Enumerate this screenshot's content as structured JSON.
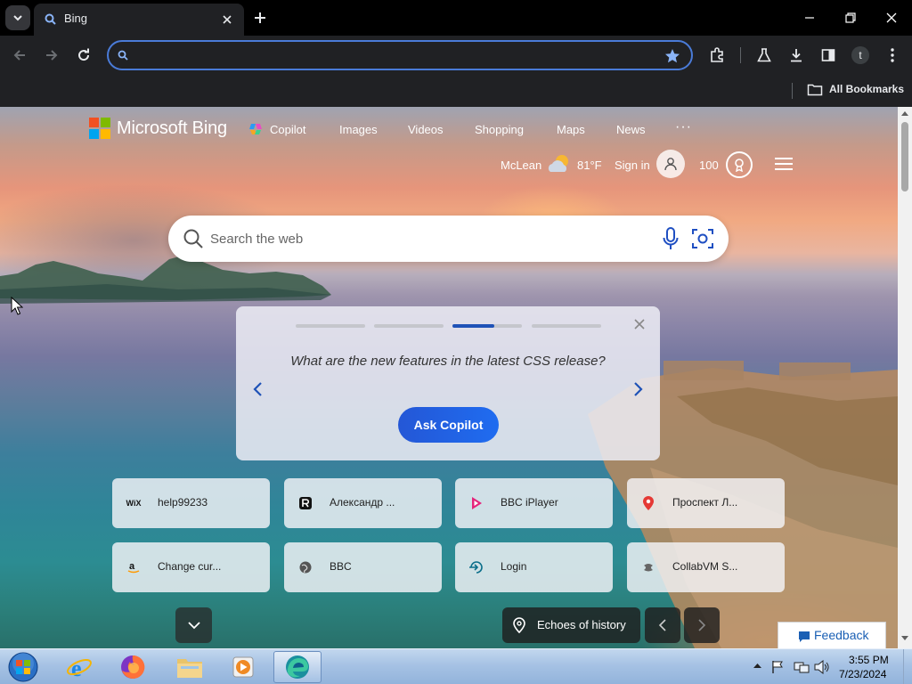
{
  "browser": {
    "tab": {
      "title": "Bing"
    },
    "omnibox": {
      "value": ""
    },
    "bookmarks_bar": {
      "all_bookmarks_label": "All Bookmarks"
    },
    "profile_initial": "t"
  },
  "bing": {
    "brand": "Microsoft Bing",
    "nav": [
      "Copilot",
      "Images",
      "Videos",
      "Shopping",
      "Maps",
      "News"
    ],
    "more": "···",
    "location": "McLean",
    "temperature": "81°F",
    "sign_in": "Sign in",
    "points": "100",
    "search_placeholder": "Search the web",
    "carousel": {
      "prompt": "What are the new features in the latest CSS release?",
      "button": "Ask Copilot",
      "active_index": 2,
      "count": 4
    },
    "quick_links": [
      {
        "label": "help99233",
        "icon": "wix-icon"
      },
      {
        "label": "Александр ...",
        "icon": "r-app-icon"
      },
      {
        "label": "BBC iPlayer",
        "icon": "bbc-iplayer-icon"
      },
      {
        "label": "Проспект Л...",
        "icon": "map-pin-icon"
      },
      {
        "label": "Change cur...",
        "icon": "amazon-icon"
      },
      {
        "label": "BBC",
        "icon": "globe-icon"
      },
      {
        "label": "Login",
        "icon": "login-icon"
      },
      {
        "label": "CollabVM S...",
        "icon": "collabvm-icon"
      }
    ],
    "image_caption": "Echoes of history",
    "feedback": "Feedback"
  },
  "taskbar": {
    "time": "3:55 PM",
    "date": "7/23/2024",
    "apps": [
      "internet-explorer-icon",
      "firefox-icon",
      "file-explorer-icon",
      "media-player-icon",
      "edge-icon"
    ]
  },
  "colors": {
    "accent": "#1f6cf0",
    "omnibox_border": "#4a7bd8",
    "chrome_bg": "#202124",
    "feedback_text": "#1a5fb4"
  }
}
